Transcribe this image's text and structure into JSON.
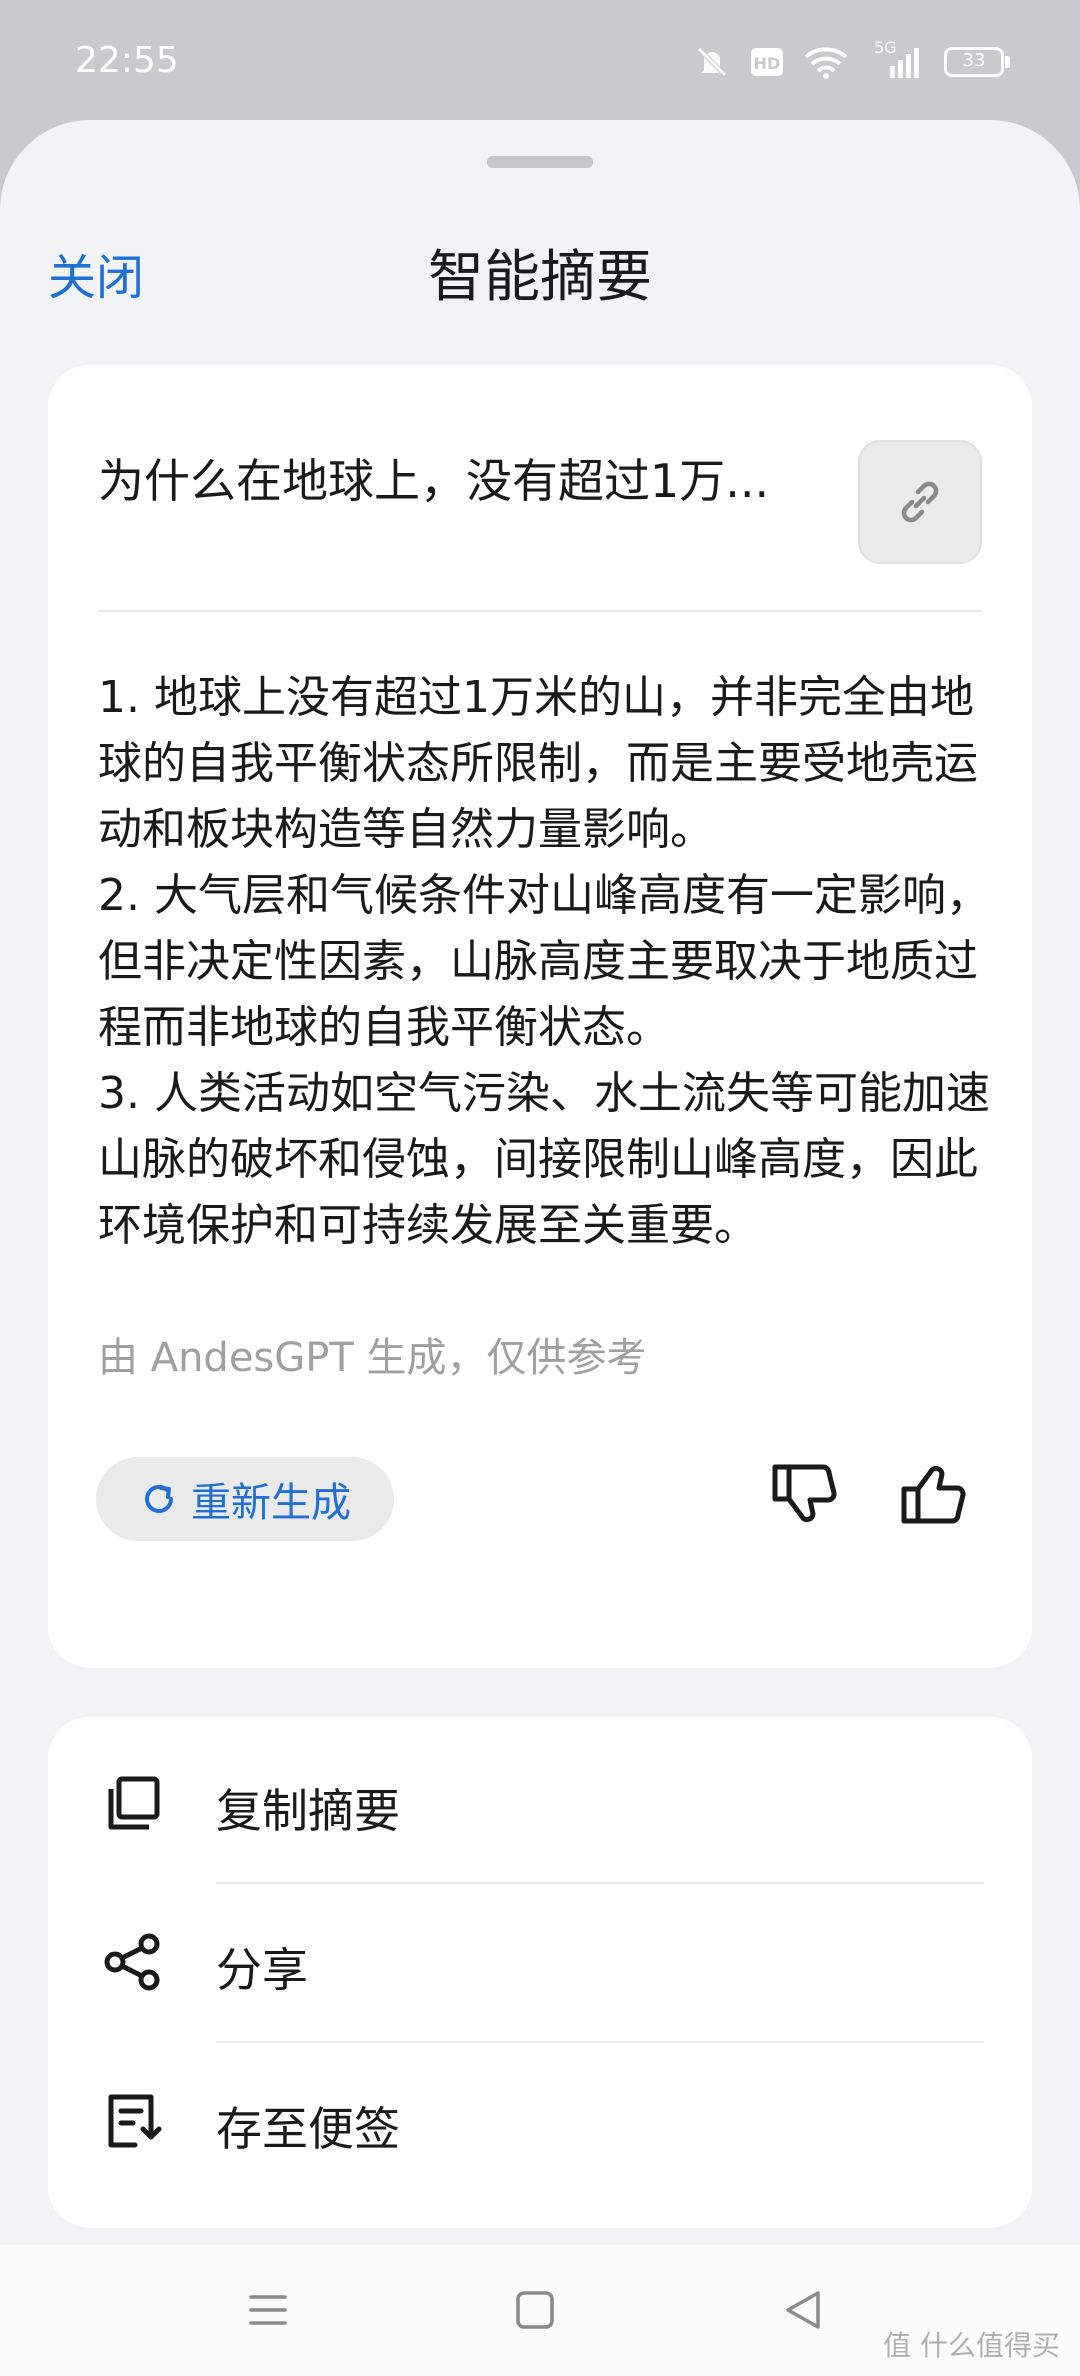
{
  "status_bar": {
    "time": "22:55",
    "icons": [
      "mute-icon",
      "hd-icon",
      "wifi-icon",
      "signal-5g-icon",
      "battery-icon"
    ],
    "network_label": "5G",
    "battery_level": "33"
  },
  "header": {
    "close_label": "关闭",
    "title": "智能摘要"
  },
  "summary": {
    "title": "为什么在地球上，没有超过1万...",
    "link_icon": "link-icon",
    "points": [
      "1. 地球上没有超过1万米的山，并非完全由地球的自我平衡状态所限制，而是主要受地壳运动和板块构造等自然力量影响。",
      "2. 大气层和气候条件对山峰高度有一定影响，但非决定性因素，山脉高度主要取决于地质过程而非地球的自我平衡状态。",
      "3. 人类活动如空气污染、水土流失等可能加速山脉的破坏和侵蚀，间接限制山峰高度，因此环境保护和可持续发展至关重要。"
    ],
    "note": "由 AndesGPT 生成，仅供参考",
    "regenerate_label": "重新生成"
  },
  "actions": [
    {
      "label": "复制摘要",
      "icon": "copy-icon"
    },
    {
      "label": "分享",
      "icon": "share-icon"
    },
    {
      "label": "存至便签",
      "icon": "note-icon"
    }
  ],
  "colors": {
    "accent": "#1f6fd6",
    "background": "#f2f3f5",
    "card": "#ffffff",
    "muted_text": "#a0a0a0"
  },
  "watermark": "值 什么值得买"
}
